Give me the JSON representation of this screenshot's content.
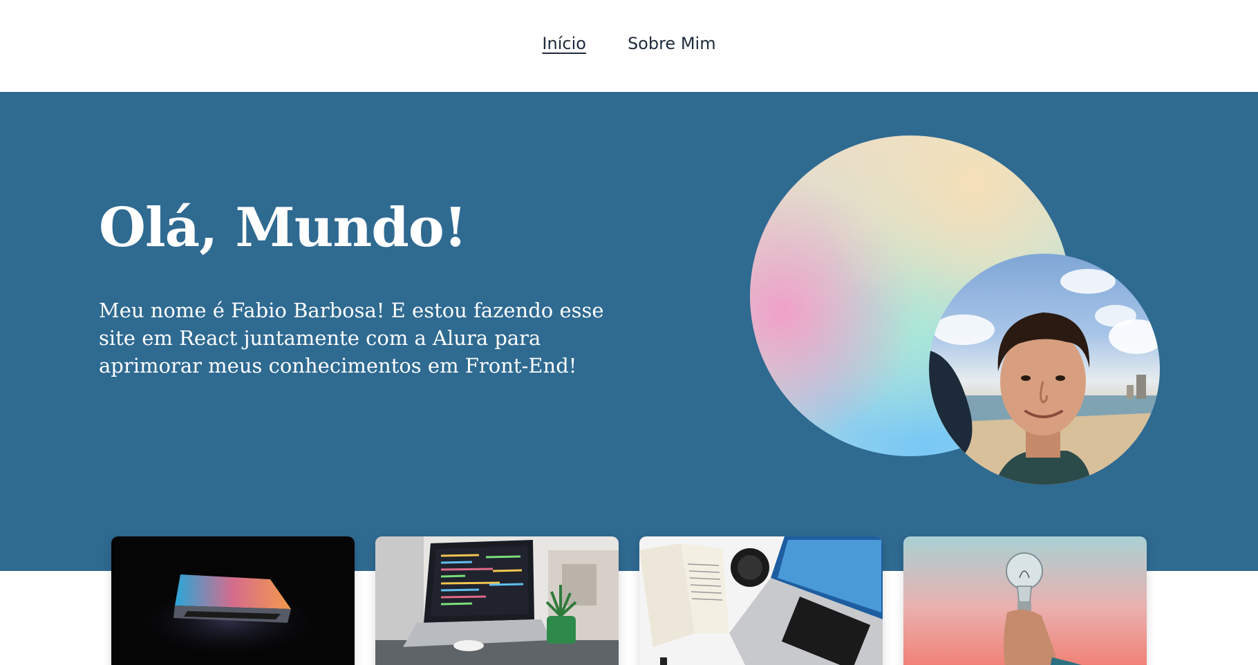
{
  "nav": {
    "items": [
      {
        "label": "Início",
        "active": true
      },
      {
        "label": "Sobre Mim",
        "active": false
      }
    ]
  },
  "hero": {
    "title": "Olá, Mundo!",
    "description": "Meu nome é Fabio Barbosa! E estou fazendo esse site em React juntamente com a Alura para aprimorar meus conhecimentos em Front-End!",
    "background_color": "#2f6a91"
  },
  "cards": [
    {
      "image": "laptop-dark-glow"
    },
    {
      "image": "laptop-code-desk"
    },
    {
      "image": "laptop-book-camera"
    },
    {
      "image": "lightbulb-hand"
    }
  ]
}
